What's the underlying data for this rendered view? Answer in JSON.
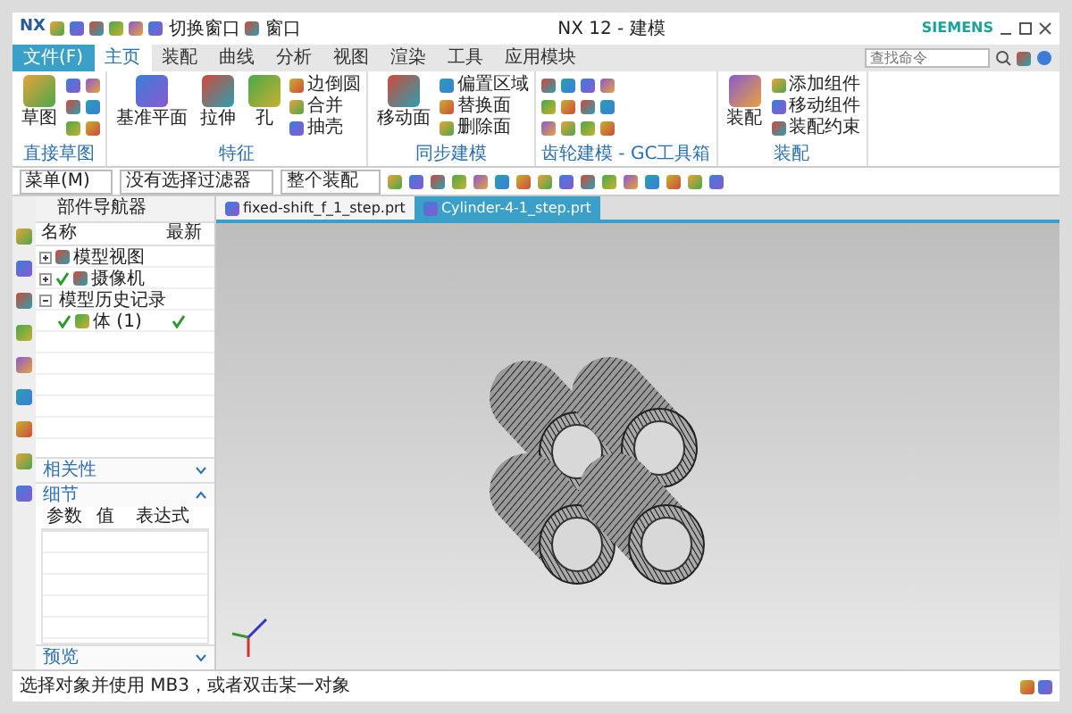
{
  "window": {
    "logo": "NX",
    "title": "NX 12 - 建模",
    "brand": "SIEMENS",
    "search_placeholder": "查找命令"
  },
  "quick_access": [
    {
      "label": "切换窗口"
    },
    {
      "label": "窗口"
    }
  ],
  "menu_tabs": [
    {
      "label": "文件(F)",
      "kind": "file",
      "selected": false
    },
    {
      "label": "主页",
      "kind": "tab",
      "selected": true
    },
    {
      "label": "装配",
      "kind": "tab",
      "selected": false
    },
    {
      "label": "曲线",
      "kind": "tab",
      "selected": false
    },
    {
      "label": "分析",
      "kind": "tab",
      "selected": false
    },
    {
      "label": "视图",
      "kind": "tab",
      "selected": false
    },
    {
      "label": "渲染",
      "kind": "tab",
      "selected": false
    },
    {
      "label": "工具",
      "kind": "tab",
      "selected": false
    },
    {
      "label": "应用模块",
      "kind": "tab",
      "selected": false
    }
  ],
  "ribbon_groups": [
    {
      "label": "直接草图",
      "buttons": [
        {
          "kind": "large",
          "label": "草图"
        },
        {
          "kind": "icon"
        },
        {
          "kind": "icon"
        },
        {
          "kind": "icon"
        },
        {
          "kind": "icon"
        },
        {
          "kind": "icon"
        },
        {
          "kind": "icon"
        }
      ]
    },
    {
      "label": "特征",
      "buttons": [
        {
          "kind": "large",
          "label": "基准平面"
        },
        {
          "kind": "large",
          "label": "拉伸"
        },
        {
          "kind": "large",
          "label": "孔"
        },
        {
          "kind": "small",
          "label": "边倒圆"
        },
        {
          "kind": "small",
          "label": "合并"
        },
        {
          "kind": "small",
          "label": "抽壳"
        }
      ]
    },
    {
      "label": "同步建模",
      "buttons": [
        {
          "kind": "large",
          "label": "移动面"
        },
        {
          "kind": "small",
          "label": "偏置区域"
        },
        {
          "kind": "small",
          "label": "替换面"
        },
        {
          "kind": "small",
          "label": "删除面"
        }
      ]
    },
    {
      "label": "齿轮建模 - GC工具箱",
      "buttons": [
        {
          "kind": "icon"
        },
        {
          "kind": "icon"
        },
        {
          "kind": "icon"
        },
        {
          "kind": "icon"
        },
        {
          "kind": "icon"
        },
        {
          "kind": "icon"
        },
        {
          "kind": "icon"
        },
        {
          "kind": "icon"
        },
        {
          "kind": "icon"
        },
        {
          "kind": "icon"
        },
        {
          "kind": "icon"
        },
        {
          "kind": "icon"
        }
      ]
    },
    {
      "label": "装配",
      "buttons": [
        {
          "kind": "large",
          "label": "装配"
        },
        {
          "kind": "small",
          "label": "添加组件"
        },
        {
          "kind": "small",
          "label": "移动组件"
        },
        {
          "kind": "small",
          "label": "装配约束"
        }
      ]
    }
  ],
  "selection_bar": {
    "menu": "菜单(M)",
    "dropdowns": [
      "没有选择过滤器",
      "整个装配"
    ]
  },
  "doc_tabs": [
    {
      "label": "fixed-shift_f_1_step.prt",
      "selected": false
    },
    {
      "label": "Cylinder-4-1_step.prt",
      "selected": true
    }
  ],
  "navigator": {
    "title": "部件导航器",
    "columns": [
      "名称",
      "最新"
    ],
    "tree": [
      {
        "label": "模型视图",
        "expanded": false,
        "checked": false,
        "latest": false
      },
      {
        "label": "摄像机",
        "expanded": false,
        "checked": true,
        "latest": false
      },
      {
        "label": "模型历史记录",
        "expanded": true,
        "checked": false,
        "latest": false,
        "children": [
          {
            "label": "体 (1)",
            "checked": true,
            "latest": true
          }
        ]
      }
    ]
  },
  "panels": [
    {
      "label": "相关性",
      "expanded": false
    },
    {
      "label": "细节",
      "expanded": true,
      "columns": [
        "参数",
        "值",
        "表达式"
      ]
    },
    {
      "label": "预览",
      "expanded": false
    }
  ],
  "status_bar": {
    "message": "选择对象并使用 MB3，或者双击某一对象"
  }
}
